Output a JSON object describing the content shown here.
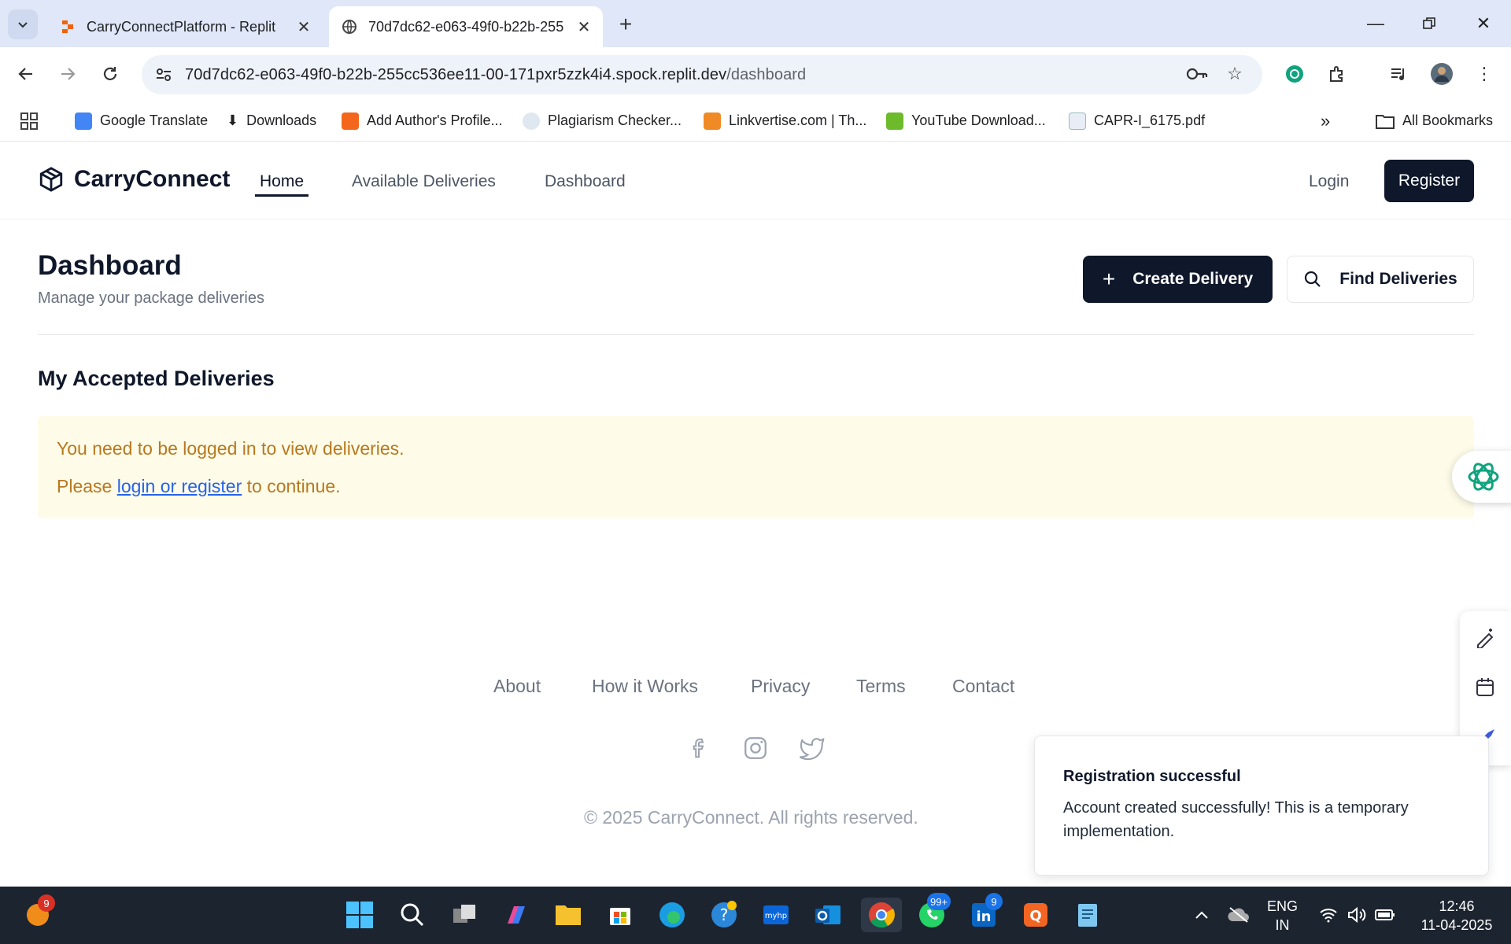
{
  "browser": {
    "tabs": [
      {
        "title": "CarryConnectPlatform - Replit",
        "active": false
      },
      {
        "title": "70d7dc62-e063-49f0-b22b-255",
        "active": true
      }
    ],
    "url_main": "70d7dc62-e063-49f0-b22b-255cc536ee11-00-171pxr5zzk4i4.spock.replit.dev",
    "url_path": "/dashboard",
    "bookmarks": [
      "Google Translate",
      "Downloads",
      "Add Author's Profile...",
      "Plagiarism Checker...",
      "Linkvertise.com | Th...",
      "YouTube Download...",
      "CAPR-I_6175.pdf"
    ],
    "all_bookmarks": "All Bookmarks"
  },
  "site": {
    "brand": "CarryConnect",
    "nav": [
      "Home",
      "Available Deliveries",
      "Dashboard"
    ],
    "login": "Login",
    "register": "Register"
  },
  "dashboard": {
    "title": "Dashboard",
    "subtitle": "Manage your package deliveries",
    "create_button": "Create Delivery",
    "find_button": "Find Deliveries",
    "section_title": "My Accepted Deliveries",
    "alert_line1": "You need to be logged in to view deliveries.",
    "alert_prefix": "Please",
    "alert_link": "login or register",
    "alert_suffix": "to continue."
  },
  "footer": {
    "links": [
      "About",
      "How it Works",
      "Privacy",
      "Terms",
      "Contact"
    ],
    "copyright": "© 2025 CarryConnect. All rights reserved."
  },
  "toast": {
    "title": "Registration successful",
    "body": "Account created successfully! This is a temporary implementation."
  },
  "taskbar": {
    "badge_left": "9",
    "whatsapp_badge": "99+",
    "linkedin_badge": "9",
    "lang1": "ENG",
    "lang2": "IN",
    "time": "12:46",
    "date": "11-04-2025"
  },
  "colors": {
    "primary": "#0f172a",
    "alert_bg": "#fefbe8",
    "alert_text": "#b7791f",
    "link": "#2563eb"
  }
}
